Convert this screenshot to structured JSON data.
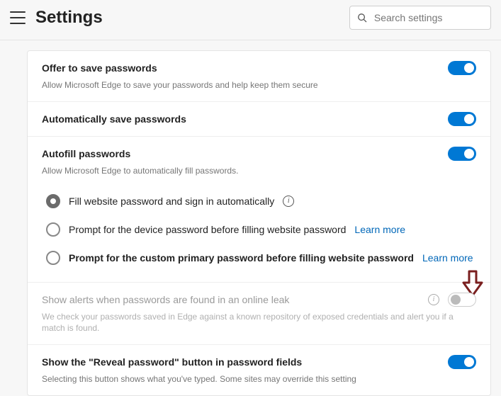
{
  "header": {
    "title": "Settings",
    "search_placeholder": "Search settings"
  },
  "sections": {
    "offer_save": {
      "title": "Offer to save passwords",
      "desc": "Allow Microsoft Edge to save your passwords and help keep them secure"
    },
    "auto_save": {
      "title": "Automatically save passwords"
    },
    "autofill": {
      "title": "Autofill passwords",
      "desc": "Allow Microsoft Edge to automatically fill passwords.",
      "opt1": "Fill website password and sign in automatically",
      "opt2": "Prompt for the device password before filling website password",
      "opt3": "Prompt for the custom primary password before filling website password",
      "learn_more": "Learn more"
    },
    "alerts": {
      "title": "Show alerts when passwords are found in an online leak",
      "desc": "We check your passwords saved in Edge against a known repository of exposed credentials and alert you if a match is found."
    },
    "reveal": {
      "title": "Show the \"Reveal password\" button in password fields",
      "desc": "Selecting this button shows what you've typed. Some sites may override this setting"
    }
  }
}
